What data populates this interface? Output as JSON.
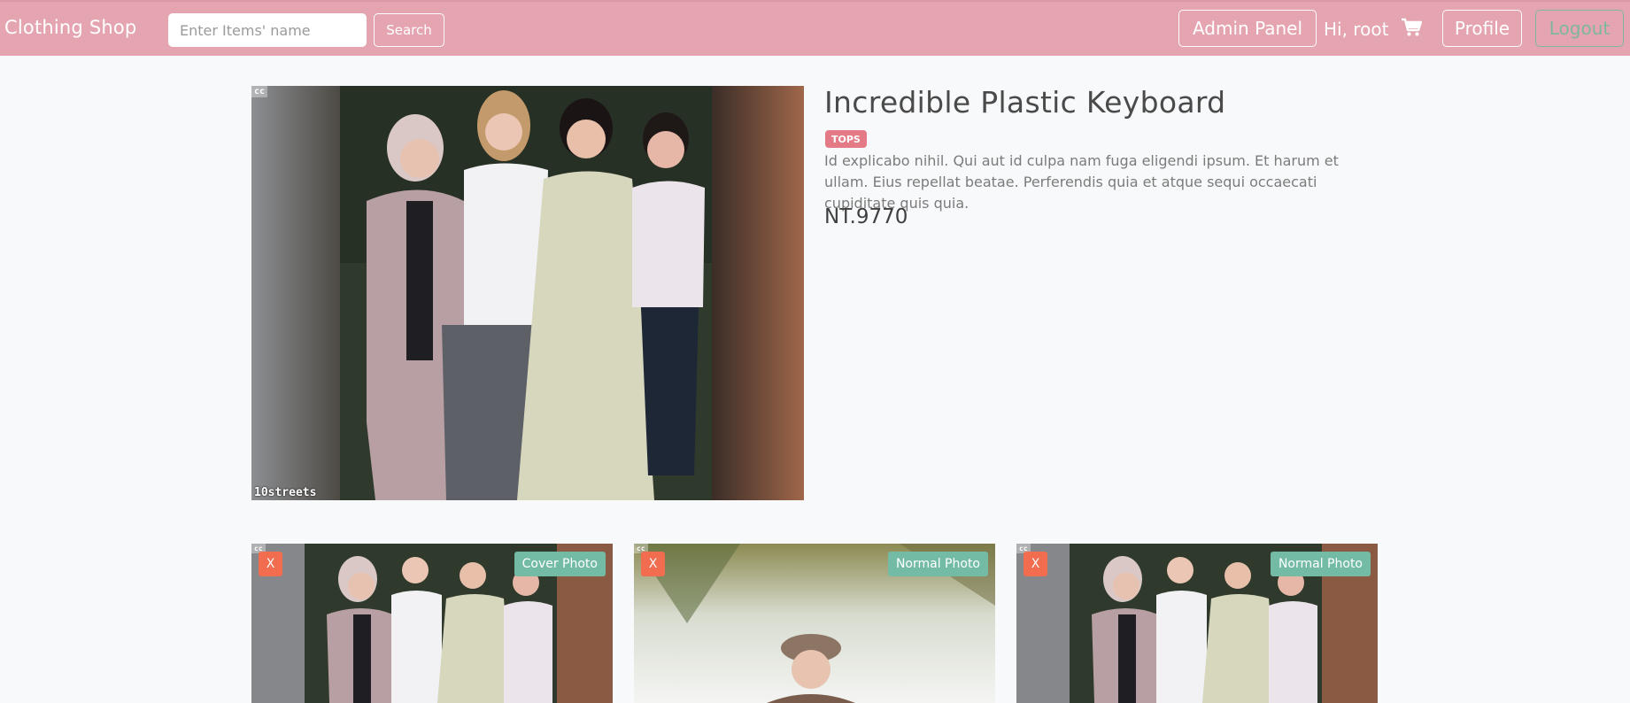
{
  "navbar": {
    "brand": "Clothing Shop",
    "search_placeholder": "Enter Items' name",
    "search_label": "Search",
    "admin_label": "Admin Panel",
    "greeting": "Hi, root",
    "cart_icon": "cart-icon",
    "profile_label": "Profile",
    "logout_label": "Logout",
    "colors": {
      "bar": "#e5a5b0",
      "logout": "#7fb69e"
    }
  },
  "product": {
    "main_photo": {
      "cc": "cc",
      "watermark": "10streets"
    },
    "title": "Incredible Plastic Keyboard",
    "category": "TOPS",
    "description": "Id explicabo nihil. Qui aut id culpa nam fuga eligendi ipsum. Et harum et ullam. Eius repellat beatae. Perferendis quia et atque sequi occaecati cupiditate quis quia.",
    "price": "NT.9770"
  },
  "photos": [
    {
      "cc": "cc",
      "remove_label": "X",
      "type_label": "Cover Photo"
    },
    {
      "cc": "cc",
      "remove_label": "X",
      "type_label": "Normal Photo"
    },
    {
      "cc": "cc",
      "remove_label": "X",
      "type_label": "Normal Photo"
    }
  ],
  "colors": {
    "remove": "#f26c4f",
    "type_badge": "#74bba6",
    "category_badge": "#e47a86"
  }
}
